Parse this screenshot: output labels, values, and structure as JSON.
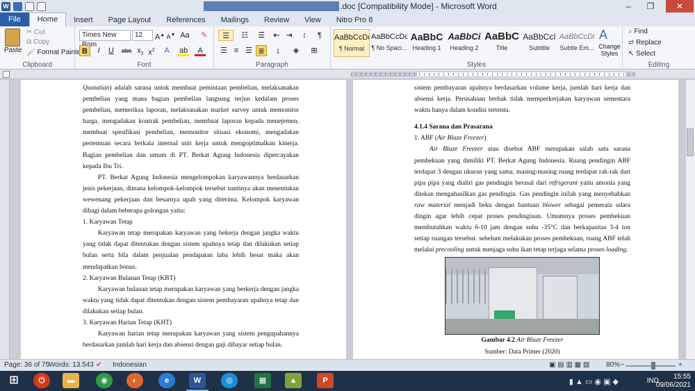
{
  "window": {
    "title": ".doc [Compatibility Mode] - Microsoft Word",
    "minimize": "–",
    "restore": "❐",
    "close": "✕"
  },
  "tabs": [
    "File",
    "Home",
    "Insert",
    "Page Layout",
    "References",
    "Mailings",
    "Review",
    "View",
    "Nitro Pro 8"
  ],
  "ribbon": {
    "clipboard": {
      "label": "Clipboard",
      "paste": "Paste",
      "cut": "Cut",
      "copy": "Copy",
      "format_painter": "Format Painter"
    },
    "font": {
      "label": "Font",
      "font_name": "Times New Rom",
      "font_size": "12"
    },
    "paragraph": {
      "label": "Paragraph"
    },
    "styles": {
      "label": "Styles",
      "items": [
        {
          "preview": "AaBbCcDc",
          "name": "¶ Normal"
        },
        {
          "preview": "AaBbCcDc",
          "name": "¶ No Spaci..."
        },
        {
          "preview": "AaBbC",
          "name": "Heading 1"
        },
        {
          "preview": "AaBbCi",
          "name": "Heading 2"
        },
        {
          "preview": "AaBbC",
          "name": "Title"
        },
        {
          "preview": "AaBbCcI",
          "name": "Subtitle"
        },
        {
          "preview": "AaBbCcDi",
          "name": "Subtle Em..."
        }
      ],
      "change_styles": "Change Styles"
    },
    "editing": {
      "label": "Editing",
      "find": "Find",
      "replace": "Replace",
      "select": "Select"
    }
  },
  "page_left": {
    "paragraphs": [
      {
        "type": "mixed",
        "parts": [
          {
            "t": "Quotatian",
            "i": true
          },
          {
            "t": ") adalah sarana untuk membuat pemintaan pembelian, melaksanakan pembelian yang mana bagian pembelian langsung terjun kedalam proses pembelian, memeriksa laporan, melaksanakan market survey untuk memonitor harga, mengadakan kontrak pembelian, membuat laporan kepada menejemen, membuat spesifikasi pembelian, memonitor situasi ekonomi, mengadakan pertemuan secara berkala internal unit kerja untuk mengoptimalkan kinerja. Bagian pembelian dan umum di PT. Berkat Agung Indonesia dipercayakan kepada Ibu Tri."
          }
        ]
      },
      {
        "type": "indent",
        "text": "PT. Berkat Agung Indonesia mengelompokan karyawannya berdasarkan jenis pekerjaan, dimana kelompok-kelompok tersebut nantinya akan menentukan wewenang pekerjaan dan besarnya upah yang diterima. Kelompok karyawan dibagi dalam beberapa golongan yaitu:"
      },
      {
        "type": "plain",
        "text": "1. Karyawan Tetap"
      },
      {
        "type": "indent",
        "text": "Karyawan tetap merupakan karyawan yang bekerja dengan jangka waktu yang tidak dapat ditentukan dengan sistem upahnya tetap dan dilakukan setiap bulan serta bila dalam penjualan pendapatan laba lebih besar maka akan mendapatkan bonus."
      },
      {
        "type": "plain",
        "text": "2. Karyawan Bulanan Tetap (KBT)"
      },
      {
        "type": "indent",
        "text": "Karyawan bulanan tetap merupakan karyawan yang berkerja dengan jangka waktu yang tidak dapat ditentukan dengan sistem pembayaran upahnya tetap dan dilakukan setiap bulan."
      },
      {
        "type": "plain",
        "text": "3. Karyawan Harian Tetap (KHT)"
      },
      {
        "type": "indent",
        "text": "Karyawan harian tetap merupakan karyawan yang sistem pengupahannya berdasarkan jumlah hari kerja dan absensi dengan gaji dibayar setiap bulan."
      }
    ]
  },
  "page_right": {
    "intro": "sistem pembayaran upahnya berdasarkan volume kerja, jumlah hari kerja dan absensi kerja. Perusahaan berhak tidak memperkerjakan karyawan sementara waktu hanya dalam kondisi tertentu.",
    "heading": "4.1.4 Sarana dan Prasarana",
    "item1_prefix": "1. ABF (",
    "item1_italic": "Air Blaze Freezer",
    "item1_suffix": ")",
    "body_parts": [
      {
        "t": "Air Blaze Freezer",
        "i": true
      },
      {
        "t": " atau disebut ABF merupakan salah satu sarana pembekuan yang dimiliki PT. Berkat Agung Indonesia. Ruang pendingin ABF terdapat 3 dengan ukuran yang sama, masing-masing ruang terdapat rak-rak dari pipa pipa yang dialiri gas pendingin berasal dari "
      },
      {
        "t": "refrigerant",
        "i": true
      },
      {
        "t": " yaitu amonia yang ditekan mengahasilkan gas pendingin. Gas pendingin inilah yang menyebabkan "
      },
      {
        "t": "raw material",
        "i": true
      },
      {
        "t": " menjadi beku dengan bantuan "
      },
      {
        "t": "blower",
        "i": true
      },
      {
        "t": " sebagai pemerata udara dingin agar lebih cepat proses pendinginan. Umumnya proses pembekuan membutuhkan waktu 6-10 jam dengan suhu -35°C dan berkapasitas 3-4 ton setiap ruangan tersebut. sebelum melakukan proses pembekuan, ruang ABF telah melalui "
      },
      {
        "t": "precooling",
        "i": true
      },
      {
        "t": " untuk menjaga suhu ikan tetap terjaga selama proses "
      },
      {
        "t": "loading",
        "i": true
      },
      {
        "t": "."
      }
    ],
    "caption_bold": "Gambar 4.2 ",
    "caption_italic": "Air Blaze Freezer",
    "source": "Sumber: Data Primer (2020)"
  },
  "status": {
    "page": "Page: 36 of 75",
    "words": "Words: 13.543",
    "language": "Indonesian",
    "zoom": "80%",
    "zoom_level": 0.8
  },
  "taskbar": {
    "time": "15:55",
    "date": "09/06/2021",
    "lang": "IND"
  },
  "colors": {
    "word_blue": "#2b579a",
    "file_tab": "#2b5ea8",
    "close_red": "#c84a3c",
    "taskbar": "#1f3147"
  }
}
